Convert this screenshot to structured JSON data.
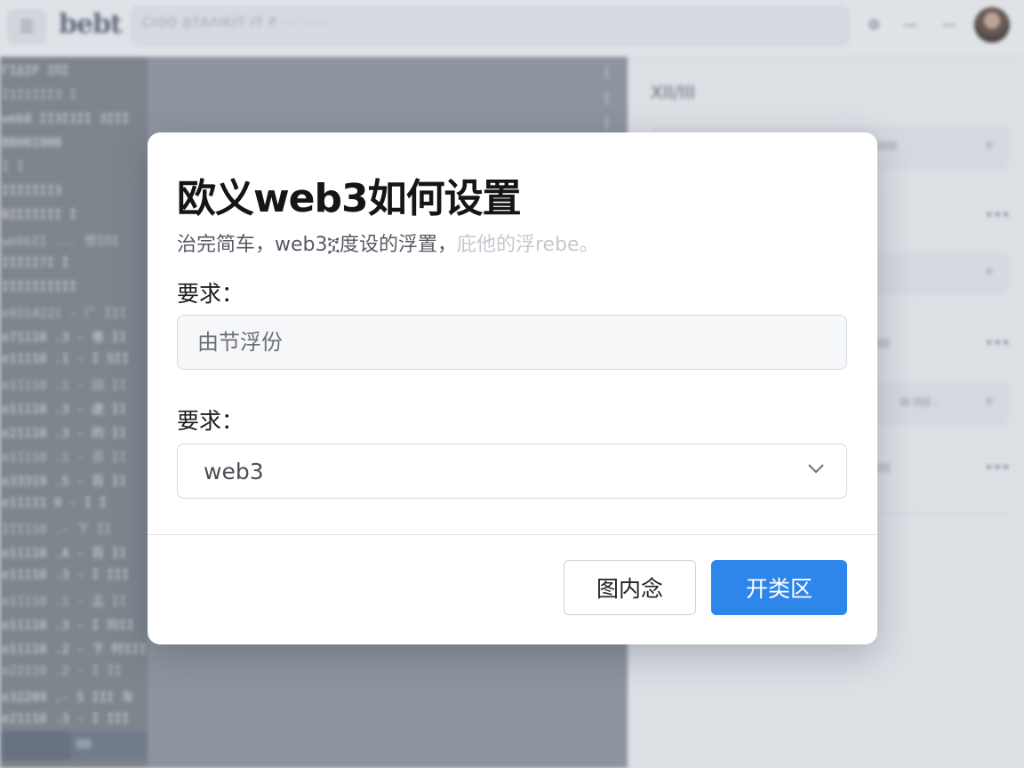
{
  "header": {
    "logo": "bebt",
    "search_text": "CIOO ΔΤΑΛΙΚΙΤ ΙΤ Ρ ··· ······",
    "icons": [
      "settings-icon",
      "minimize-icon",
      "more-icon"
    ]
  },
  "code_panel": {
    "lines": [
      "ΓΙΔΙΡ ΙΠΙ",
      "Ι1Ι1ΙΙΙ3  Ι",
      "web8 ΙΙ3Ι1ΙΙ 3ΙΙΙ",
      "ΒΒΘΘΙΘΘΘ",
      "Ι      Ι",
      "ΙΙΙΙΙΙΙ3",
      "ΒΙΣΙΙΙΙΙ  Ι",
      "webbΙΙ ... 惯ΙΠΙ",
      "ΙΙΙΙΙ7Ι  Ι",
      "ΙΙΙΙΙΙΙΙΙΙ",
      "e9314221 - 广 ΙΙΙ",
      "e71110 .3 - 卷 ΙΙ",
      "e11110 .1 - Ι 5ΙΙ",
      "e11110 .1 - 田 ΙΙ",
      "e11110 .3 - 虚 ΙΙ",
      "e21110 .3 - 的 ΙΙ",
      "e11110 .1 - 百 ΙΙ",
      "e33319 .5 - 百 ΙΙ",
      "e11111 0 - Ι Ι",
      "ΙΙΙ110 .- 下 ΙΙ",
      "e11110 .A - 百 ΙΙ",
      "e11110 .3 - Ι ΙΙΙ",
      "e11110 .1 - 孟 ΙΙ",
      "e11110 .3 - Ι 均ΙΙ",
      "e11110 .2 - 下 时ΙΙΙ",
      "e22110 .2 - Ι ΙΙ",
      "e32289 .- 5 ΙΙΙ 车",
      "e21110 .3 - Ι ΙΙΙ"
    ],
    "footer_button": "ΙΙΙΙ"
  },
  "right_panel": {
    "title": "ΧΙΙ/ΙΙΙ",
    "rows": [
      {
        "text": "ΙΙΙΙΙΙΙ"
      },
      {
        "text": "ΙΙΙ"
      },
      {
        "text": "ΙΙΙΙ"
      },
      {
        "text": "ΙΙΙ ΙΙΙΙΙ -"
      },
      {
        "text": "ΙΙΙΙ"
      }
    ]
  },
  "modal": {
    "title": "欧义web3如何设置",
    "subtitle": "治完简车，web3ኟ度设的浮置，",
    "subtitle_faded": "庇他的浮rebe。",
    "field1_label": "要求：",
    "field1_placeholder": "由节浮份",
    "field2_label": "要求：",
    "field2_value": "web3",
    "cancel_label": "图内念",
    "confirm_label": "开类区",
    "colors": {
      "primary": "#2f86ea",
      "title": "#151515"
    }
  }
}
